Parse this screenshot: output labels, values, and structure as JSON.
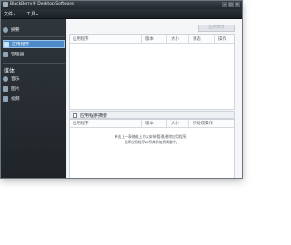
{
  "window": {
    "title": "BlackBerry® Desktop Software"
  },
  "menubar": {
    "items": [
      {
        "label": "文件"
      },
      {
        "label": "工具"
      }
    ]
  },
  "sidebar": {
    "items": [
      {
        "label": "摘要"
      },
      {
        "label": "应用程序",
        "active": true
      },
      {
        "label": "管理器"
      }
    ],
    "media_header": "媒体",
    "media_items": [
      {
        "label": "音乐"
      },
      {
        "label": "图片"
      },
      {
        "label": "视频"
      }
    ]
  },
  "toolbar": {
    "apply_button": "应用更改"
  },
  "app_table": {
    "columns": [
      "应用程序",
      "版本",
      "大小",
      "状态",
      "操作"
    ]
  },
  "summary_panel": {
    "title": "应用程序摘要",
    "columns": [
      "应用程序",
      "版本",
      "大小",
      "待处理操作"
    ],
    "message_line1": "单击上一表格或上方以安装/管理/删除应用程序。",
    "message_line2": "选择应用程序以将其添加到摘要中。"
  },
  "colors": {
    "accent": "#4e8cc9",
    "sidebar": "#2b3238",
    "titlebar": "#22282d"
  }
}
